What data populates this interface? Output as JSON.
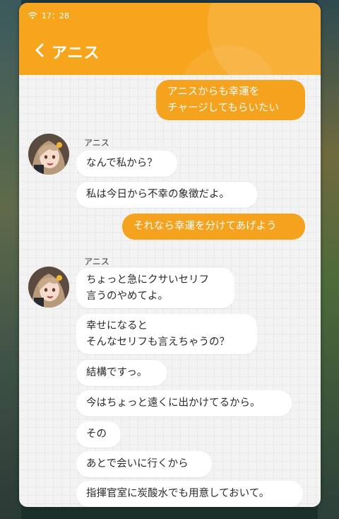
{
  "status_bar": {
    "time": "17：28",
    "wifi_icon": "wifi-icon"
  },
  "header": {
    "title": "アニス",
    "back_icon": "chevron-left-icon"
  },
  "colors": {
    "header": "#f7a51c",
    "outgoing_bubble": "#f5a21e",
    "incoming_bubble": "#ffffff",
    "background": "#f3f3f3"
  },
  "messages": {
    "m1": "アニスからも幸運を\nチャージしてもらいたい",
    "group1_sender": "アニス",
    "m2": "なんで私から？",
    "m3": "私は今日から不幸の象徴だよ。",
    "m4": "それなら幸運を分けてあげよう",
    "group2_sender": "アニス",
    "m5": "ちょっと急にクサいセリフ\n言うのやめてよ。",
    "m6": "幸せになると\nそんなセリフも言えちゃうの？",
    "m7": "結構ですっ。",
    "m8": "今はちょっと遠くに出かけてるから。",
    "m9": "その",
    "m10": "あとで会いに行くから",
    "m11": "指揮官室に炭酸水でも用意しておいて。"
  }
}
